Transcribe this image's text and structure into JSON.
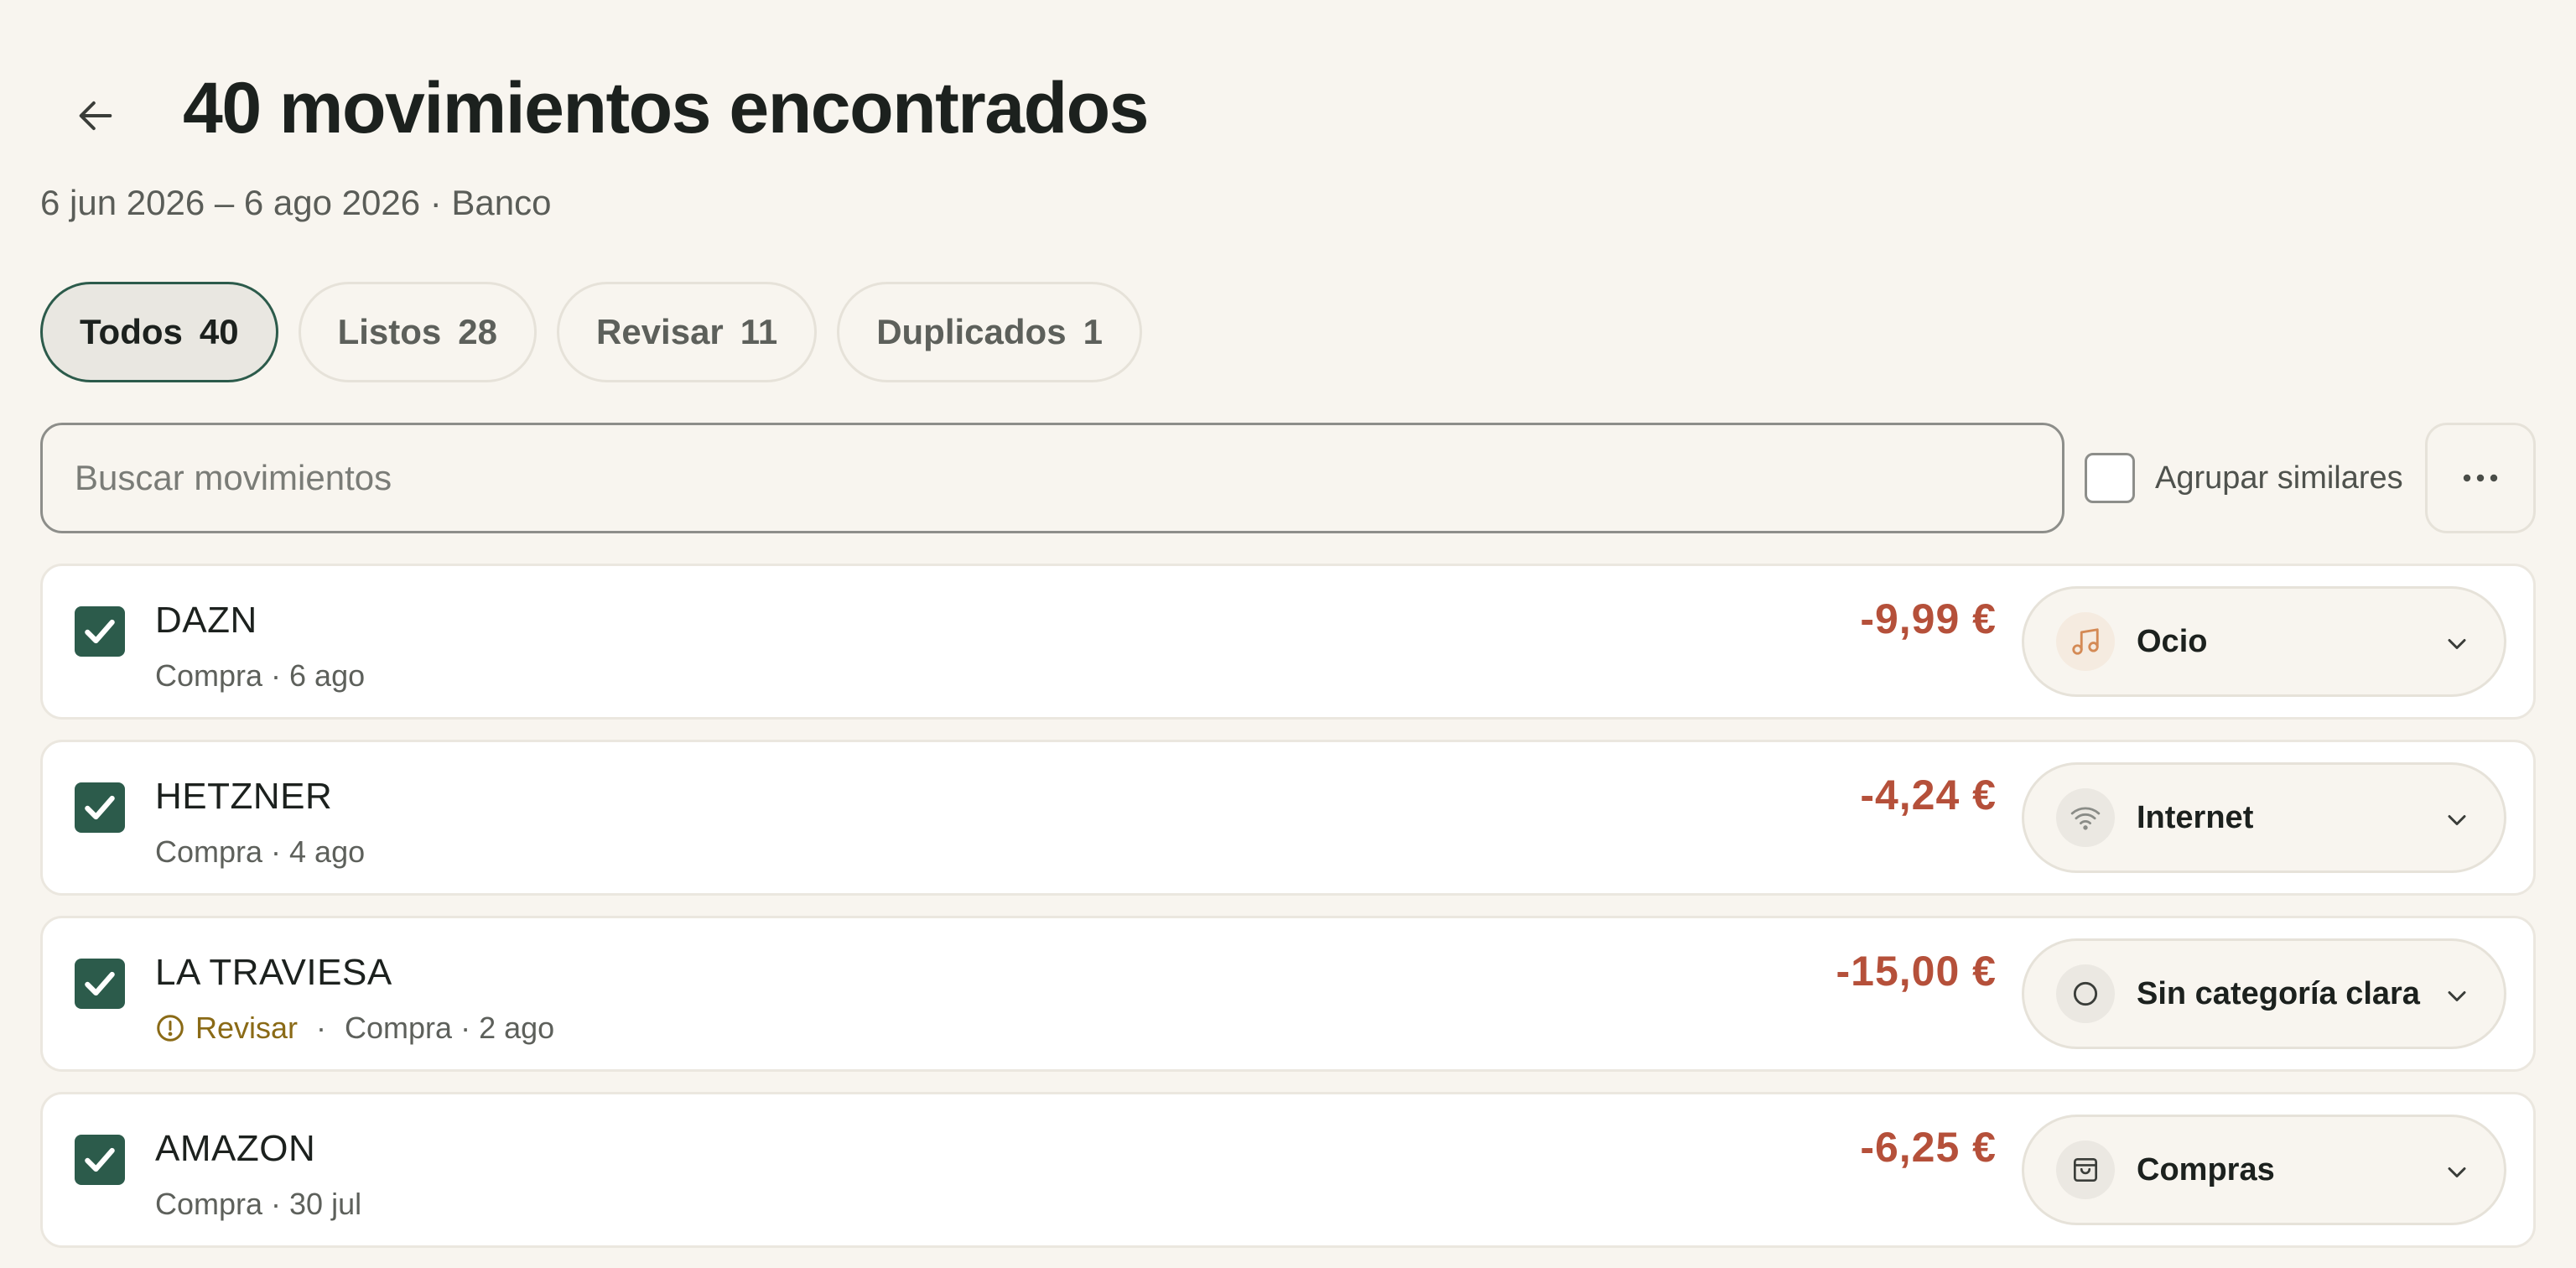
{
  "header": {
    "title": "40 movimientos encontrados",
    "subtitle": "6 jun 2026 – 6 ago 2026 · Banco"
  },
  "tabs": [
    {
      "label": "Todos",
      "count": "40",
      "active": true
    },
    {
      "label": "Listos",
      "count": "28",
      "active": false
    },
    {
      "label": "Revisar",
      "count": "11",
      "active": false
    },
    {
      "label": "Duplicados",
      "count": "1",
      "active": false
    }
  ],
  "search": {
    "placeholder": "Buscar movimientos",
    "value": ""
  },
  "group_similar": {
    "label": "Agrupar similares",
    "checked": false
  },
  "more_menu": {
    "icon": "more-horizontal-icon"
  },
  "transactions": [
    {
      "merchant": "DAZN",
      "meta": "Compra · 6 ago",
      "amount": "-9,99 €",
      "selected": true,
      "category": "Ocio",
      "category_icon": "music-icon"
    },
    {
      "merchant": "HETZNER",
      "meta": "Compra · 4 ago",
      "amount": "-4,24 €",
      "selected": true,
      "category": "Internet",
      "category_icon": "wifi-icon"
    },
    {
      "merchant": "LA TRAVIESA",
      "review_label": "Revisar",
      "meta": "Compra · 2 ago",
      "amount": "-15,00 €",
      "selected": true,
      "category": "Sin categoría clara",
      "category_icon": "circle-icon"
    },
    {
      "merchant": "AMAZON",
      "meta": "Compra · 30 jul",
      "amount": "-6,25 €",
      "selected": true,
      "category": "Compras",
      "category_icon": "shopping-bag-icon"
    }
  ],
  "colors": {
    "background": "#f8f5ef",
    "accent": "#2c5b4b",
    "amount": "#b5503a",
    "review": "#8a6a16"
  }
}
